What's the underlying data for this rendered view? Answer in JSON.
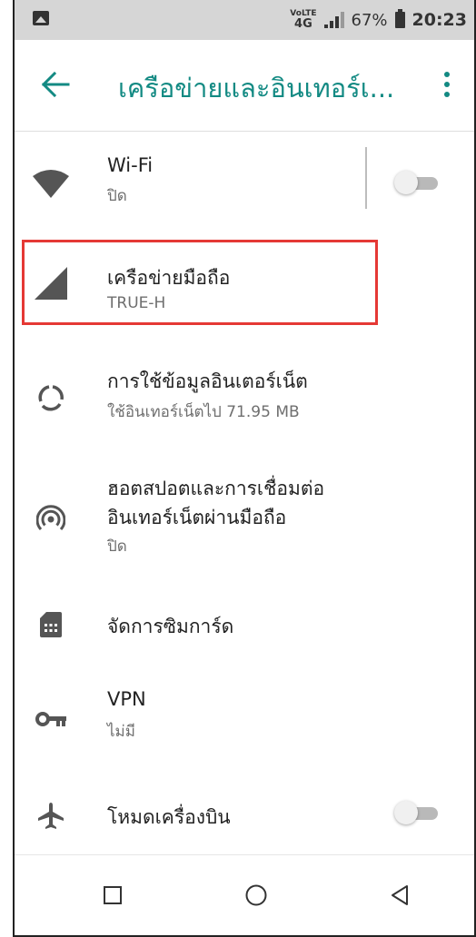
{
  "status_bar": {
    "volte_label": "VoLTE",
    "network_label": "4G",
    "battery_percent": "67%",
    "time": "20:23"
  },
  "app_bar": {
    "title": "เครือข่ายและอินเทอร์เ...",
    "accent_color": "#138a83"
  },
  "settings": {
    "wifi": {
      "title": "Wi-Fi",
      "subtitle": "ปิด",
      "toggle_on": false
    },
    "mobile_network": {
      "title": "เครือข่ายมือถือ",
      "subtitle": "TRUE-H"
    },
    "data_usage": {
      "title": "การใช้ข้อมูลอินเตอร์เน็ต",
      "subtitle": "ใช้อินเทอร์เน็ตไป 71.95 MB"
    },
    "hotspot": {
      "title_line1": "ฮอตสปอตและการเชื่อมต่อ",
      "title_line2": "อินเทอร์เน็ตผ่านมือถือ",
      "subtitle": "ปิด"
    },
    "sim_manager": {
      "title": "จัดการซิมการ์ด"
    },
    "vpn": {
      "title": "VPN",
      "subtitle": "ไม่มี"
    },
    "airplane": {
      "title": "โหมดเครื่องบิน",
      "toggle_on": false
    }
  },
  "highlight_color": "#e53935",
  "icons": [
    "wifi-icon",
    "cell-signal-icon",
    "data-usage-icon",
    "hotspot-icon",
    "sim-card-icon",
    "vpn-key-icon",
    "airplane-icon",
    "recents-icon",
    "home-icon",
    "back-icon"
  ]
}
